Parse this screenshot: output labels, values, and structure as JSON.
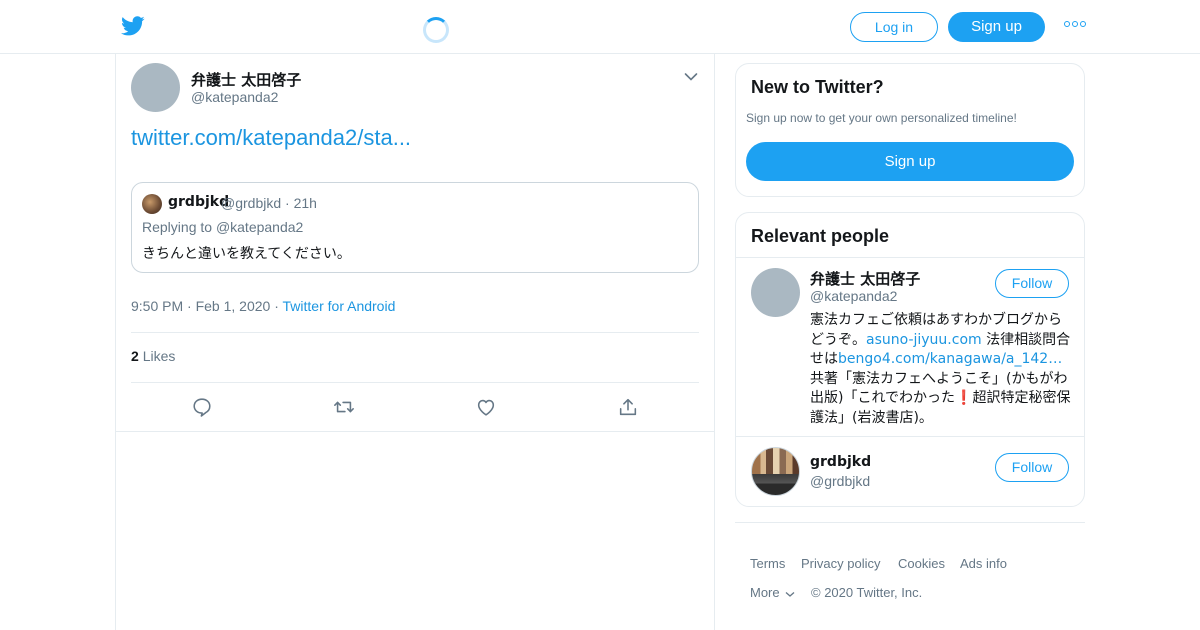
{
  "header": {
    "login_label": "Log in",
    "signup_label": "Sign up"
  },
  "tweet": {
    "author_name": "弁護士 太田啓子",
    "author_handle": "@katepanda2",
    "link_text": "twitter.com/katepanda2/sta...",
    "quoted": {
      "name": "grdbjkd",
      "handle": "@grdbjkd",
      "time": "21h",
      "replying_to_prefix": "Replying to ",
      "replying_to_handle": "@katepanda2",
      "text": "きちんと違いを教えてください。"
    },
    "time": "9:50 PM",
    "date": "Feb 1, 2020",
    "source": "Twitter for Android",
    "likes_count": "2",
    "likes_label": "Likes"
  },
  "sidebar": {
    "new_to_twitter": {
      "title": "New to Twitter?",
      "subtitle": "Sign up now to get your own personalized timeline!",
      "signup_label": "Sign up"
    },
    "relevant_people": {
      "title": "Relevant people",
      "people": [
        {
          "name": "弁護士 太田啓子",
          "handle": "@katepanda2",
          "follow_label": "Follow",
          "bio_parts": {
            "p1": "憲法カフェご依頼はあすわかブログからどうぞ。",
            "link1": "asuno-jiyuu.com",
            "p2": " 法律相談問合せは",
            "link2": "bengo4.com/kanagawa/a_142…",
            "p3": " 共著「憲法カフェへようこそ」(かもがわ出版)「これでわかった",
            "emoji": "❗",
            "p4": "超訳特定秘密保護法」(岩波書店)。"
          }
        },
        {
          "name": "grdbjkd",
          "handle": "@grdbjkd",
          "follow_label": "Follow"
        }
      ]
    },
    "footer": {
      "terms": "Terms",
      "privacy": "Privacy policy",
      "cookies": "Cookies",
      "ads": "Ads info",
      "more": "More",
      "copyright": "© 2020 Twitter, Inc."
    }
  },
  "colors": {
    "accent": "#1da1f2",
    "link": "#1b95e0",
    "secondary_text": "#657786",
    "border": "#e6ecf0"
  },
  "icons": [
    "twitter-bird-icon",
    "loading-spinner-icon",
    "more-dots-icon",
    "chevron-down-icon",
    "reply-icon",
    "retweet-icon",
    "like-icon",
    "share-icon"
  ]
}
